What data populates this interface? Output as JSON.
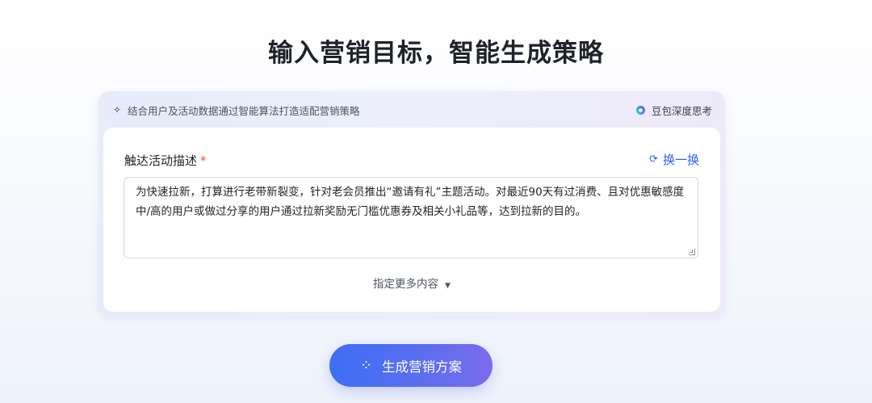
{
  "header": {
    "title": "输入营销目标，智能生成策略"
  },
  "card": {
    "hint_icon": "sparkle-icon",
    "hint_text": "结合用户及活动数据通过智能算法打造适配营销策略",
    "model_icon": "doubao-logo-icon",
    "model_label": "豆包深度思考"
  },
  "form": {
    "label": "触达活动描述",
    "required_mark": "*",
    "refresh_icon": "refresh-icon",
    "refresh_label": "换一换",
    "description": "为快速拉新，打算进行老带新裂变，针对老会员推出“邀请有礼”主题活动。对最近90天有过消费、且对优惠敏感度中/高的用户或做过分享的用户通过拉新奖励无门槛优惠券及相关小礼品等，达到拉新的目的。",
    "more_label": "指定更多内容",
    "more_icon": "caret-down-icon"
  },
  "actions": {
    "generate_icon": "loading-spark-icon",
    "generate_label": "生成营销方案"
  },
  "colors": {
    "accent": "#2b63f2",
    "required": "#f5463c",
    "button_start": "#3d6ff5",
    "button_end": "#7a6cec"
  }
}
